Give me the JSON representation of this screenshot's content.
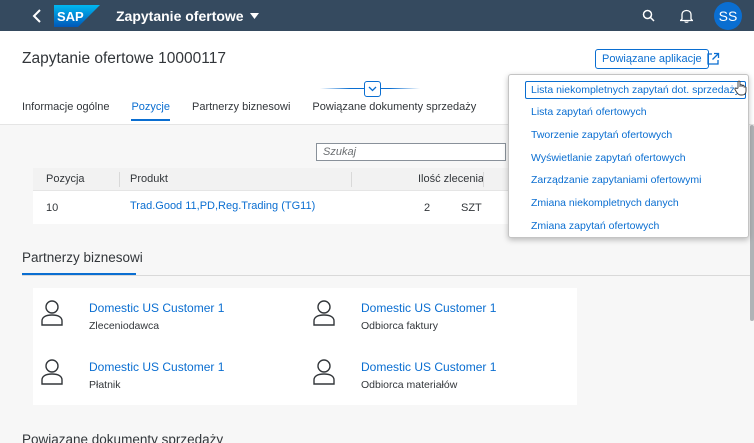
{
  "shell": {
    "logo": "SAP",
    "app_title": "Zapytanie ofertowe",
    "avatar_initials": "SS"
  },
  "header": {
    "title": "Zapytanie ofertowe 10000117",
    "related_apps_label": "Powiązane aplikacje"
  },
  "tabs": [
    {
      "label": "Informacje ogólne"
    },
    {
      "label": "Pozycje"
    },
    {
      "label": "Partnerzy biznesowi"
    },
    {
      "label": "Powiązane dokumenty sprzedaży"
    }
  ],
  "items": {
    "search_placeholder": "Szukaj",
    "columns": [
      "Pozycja",
      "Produkt",
      "Ilość zlecenia"
    ],
    "rows": [
      {
        "position": "10",
        "product": "Trad.Good 11,PD,Reg.Trading (TG11)",
        "quantity": "2",
        "unit": "SZT"
      }
    ]
  },
  "partners": {
    "title": "Partnerzy biznesowi",
    "list": [
      {
        "name": "Domestic US Customer 1",
        "role": "Zleceniodawca"
      },
      {
        "name": "Domestic US Customer 1",
        "role": "Odbiorca faktury"
      },
      {
        "name": "Domestic US Customer 1",
        "role": "Płatnik"
      },
      {
        "name": "Domestic US Customer 1",
        "role": "Odbiorca materiałów"
      }
    ]
  },
  "next_section_title": "Powiązane dokumenty sprzedaży",
  "related_apps_menu": [
    "Lista niekompletnych zapytań dot. sprzedaży",
    "Lista zapytań ofertowych",
    "Tworzenie zapytań ofertowych",
    "Wyświetlanie zapytań ofertowych",
    "Zarządzanie zapytaniami ofertowymi",
    "Zmiana niekompletnych danych",
    "Zmiana zapytań ofertowych"
  ],
  "colors": {
    "shell": "#354a5f",
    "accent": "#0a6ed1"
  }
}
